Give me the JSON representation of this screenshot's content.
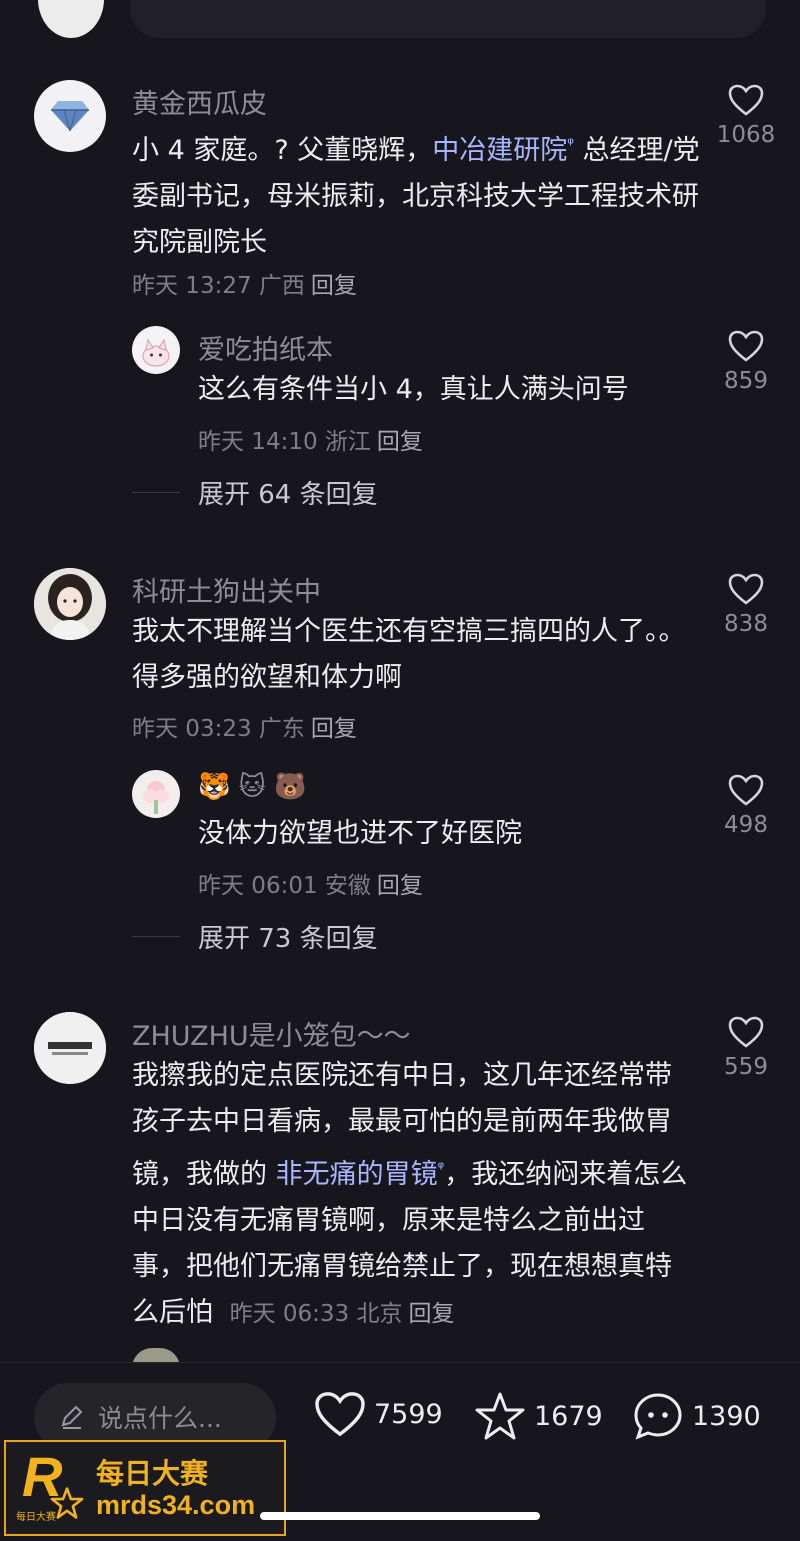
{
  "comments": [
    {
      "name": "黄金西瓜皮",
      "body_pre": "小 4 家庭。? 父董晓辉，",
      "link": "中冶建研院",
      "body_post": " 总经理/党委副书记，母米振莉，北京科技大学工程技术研究院副院长",
      "meta": "昨天 13:27 广西",
      "reply_label": "回复",
      "likes": "1068",
      "avatar_icon": "diamond-icon"
    },
    {
      "name": "爱吃拍纸本",
      "body": "这么有条件当小 4，真让人满头问号",
      "meta": "昨天 14:10 浙江",
      "reply_label": "回复",
      "likes": "859",
      "avatar_icon": "cartoon-cat-icon"
    },
    {
      "name": "科研土狗出关中",
      "body": "我太不理解当个医生还有空搞三搞四的人了。。得多强的欲望和体力啊",
      "meta": "昨天 03:23 广东",
      "reply_label": "回复",
      "likes": "838",
      "avatar_icon": "girl-portrait-icon"
    },
    {
      "name": "🐯 🐱 🐻",
      "body": "没体力欲望也进不了好医院",
      "meta": "昨天 06:01 安徽",
      "reply_label": "回复",
      "likes": "498",
      "avatar_icon": "flower-icon"
    },
    {
      "name": "ZHUZHU是小笼包～～",
      "body_pre": "我擦我的定点医院还有中日，这几年还经常带孩子去中日看病，最最可怕的是前两年我做胃镜，我做的 ",
      "link": "非无痛的胃镜",
      "body_post": "，我还纳闷来着怎么中日没有无痛胃镜啊，原来是特么之前出过事，把他们无痛胃镜给禁止了，现在想想真特么后怕",
      "meta": "昨天 06:33 北京",
      "reply_label": "回复",
      "likes": "559",
      "avatar_icon": "text-logo-icon"
    }
  ],
  "expand_replies": [
    "展开 64 条回复",
    "展开 73 条回复"
  ],
  "bottom_bar": {
    "input_placeholder": "说点什么...",
    "like_count": "7599",
    "favorite_count": "1679",
    "comment_count": "1390"
  },
  "watermark": {
    "logo_letter": "R",
    "logo_sub": "每日大赛",
    "title": "每日大赛",
    "url": "mrds34.com"
  },
  "colors": {
    "background": "#16161c",
    "link": "#a9b6ff",
    "watermark_accent": "#e6a51c"
  }
}
